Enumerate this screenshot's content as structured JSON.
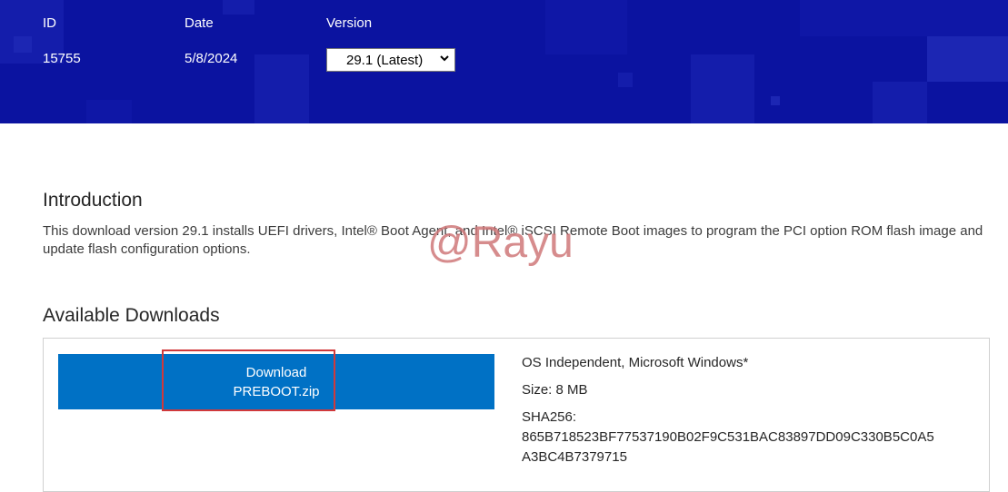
{
  "header": {
    "id_label": "ID",
    "date_label": "Date",
    "version_label": "Version",
    "id_value": "15755",
    "date_value": "5/8/2024",
    "version_selected": "29.1 (Latest)"
  },
  "intro": {
    "heading": "Introduction",
    "text": "This download version 29.1 installs UEFI drivers, Intel® Boot Agent, and Intel® iSCSI Remote Boot images to program the PCI option ROM flash image and update flash configuration options."
  },
  "downloads": {
    "heading": "Available Downloads",
    "button_line1": "Download",
    "button_line2": "PREBOOT.zip",
    "os": "OS Independent, Microsoft Windows*",
    "size": "Size: 8 MB",
    "sha_label": "SHA256:",
    "sha_line1": "865B718523BF77537190B02F9C531BAC83897DD09C330B5C0A5",
    "sha_line2": "A3BC4B7379715"
  },
  "watermark": "@Rayu",
  "colors": {
    "banner": "#0b13a0",
    "button": "#0071c5",
    "highlight": "#d0393b"
  }
}
